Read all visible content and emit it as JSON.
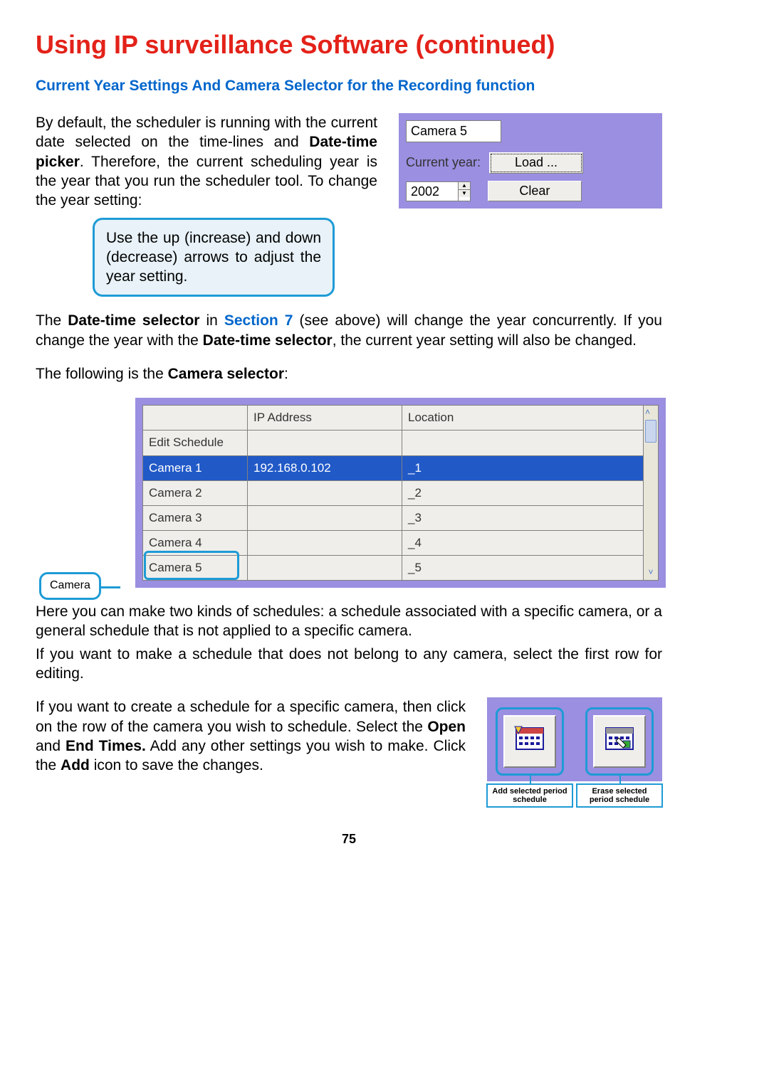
{
  "title": "Using IP surveillance Software (continued)",
  "subtitle": "Current Year Settings And Camera Selector for the Recording function",
  "intro_p1a": "By default, the scheduler is running with the current date selected on the time-lines and ",
  "intro_p1b": "Date-time picker",
  "intro_p1c": ". Therefore, the current scheduling year is the year that you run the scheduler tool. To change the year setting:",
  "callout1": "Use the up (increase) and down (decrease) arrows to adjust the year setting.",
  "panel": {
    "camera_label": "Camera 5",
    "current_year_label": "Current year:",
    "year_value": "2002",
    "load_btn": "Load ...",
    "clear_btn": "Clear"
  },
  "para2a": "The ",
  "para2b": "Date-time selector",
  "para2c": " in ",
  "para2d": "Section 7",
  "para2e": " (see above) will change the year concurrently. If you change the year with the ",
  "para2f": "Date-time selector",
  "para2g": ", the current year setting will also be changed.",
  "para3a": "The following is the ",
  "para3b": "Camera selector",
  "para3c": ":",
  "cam_table": {
    "headers": [
      "",
      "IP Address",
      "Location"
    ],
    "rows": [
      {
        "name": "Edit Schedule",
        "ip": "",
        "loc": "",
        "selected": false
      },
      {
        "name": "Camera 1",
        "ip": "192.168.0.102",
        "loc": "_1",
        "selected": true
      },
      {
        "name": "Camera 2",
        "ip": "",
        "loc": "_2",
        "selected": false
      },
      {
        "name": "Camera 3",
        "ip": "",
        "loc": "_3",
        "selected": false
      },
      {
        "name": "Camera 4",
        "ip": "",
        "loc": "_4",
        "selected": false
      },
      {
        "name": "Camera 5",
        "ip": "",
        "loc": "_5",
        "selected": false
      }
    ]
  },
  "cam_callout": "Camera",
  "para4": "Here you can make two kinds of schedules: a schedule associated with a specific camera, or  a general schedule that is not applied to a specific camera.",
  "para5": "If you want to make a schedule that does not belong to any camera, select  the first row for editing.",
  "para6a": "If you want to create a schedule for a specific camera, then click on the row of the camera you wish to schedule. Select the ",
  "para6b": "Open",
  "para6c": " and ",
  "para6d": "End Times.",
  "para6e": "  Add any other settings you wish to make. Click the ",
  "para6f": "Add",
  "para6g": " icon to save the changes.",
  "icon_add_caption": "Add selected period schedule",
  "icon_erase_caption": "Erase selected period schedule",
  "page_number": "75"
}
